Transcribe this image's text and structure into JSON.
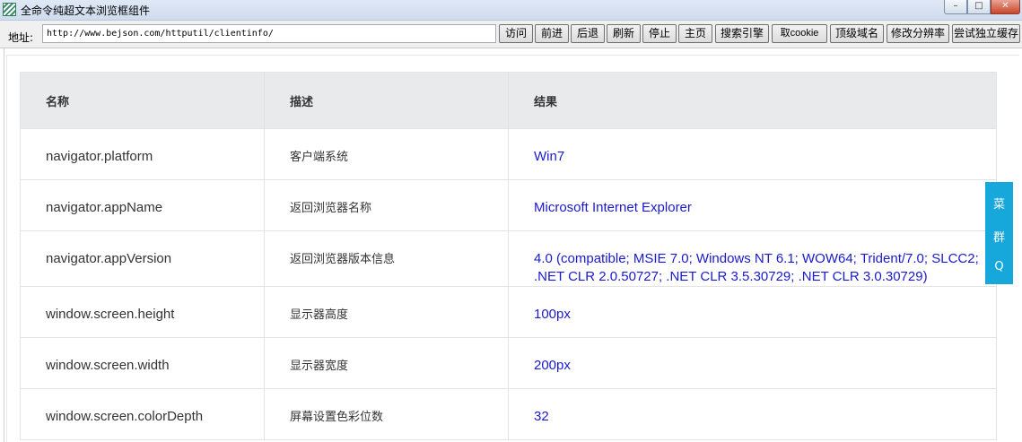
{
  "window": {
    "title": "全命令纯超文本浏览框组件",
    "controls": {
      "minimize": "–",
      "maximize": "□",
      "close": "✕"
    }
  },
  "toolbar": {
    "address_label": "地址:",
    "address_value": "http://www.bejson.com/httputil/clientinfo/",
    "buttons": [
      {
        "label": "访问"
      },
      {
        "label": "前进"
      },
      {
        "label": "后退"
      },
      {
        "label": "刷新"
      },
      {
        "label": "停止"
      },
      {
        "label": "主页"
      },
      {
        "label": "搜索引擎"
      },
      {
        "label": "取cookie"
      },
      {
        "label": "顶级域名"
      },
      {
        "label": "修改分辨率"
      },
      {
        "label": "尝试独立缓存"
      }
    ]
  },
  "table": {
    "headers": [
      "名称",
      "描述",
      "结果"
    ],
    "rows": [
      {
        "name": "navigator.platform",
        "desc": "客户端系统",
        "result": "Win7"
      },
      {
        "name": "navigator.appName",
        "desc": "返回浏览器名称",
        "result": "Microsoft Internet Explorer"
      },
      {
        "name": "navigator.appVersion",
        "desc": "返回浏览器版本信息",
        "result": "4.0 (compatible; MSIE 7.0; Windows NT 6.1; WOW64; Trident/7.0; SLCC2; .NET CLR 2.0.50727; .NET CLR 3.5.30729; .NET CLR 3.0.30729)"
      },
      {
        "name": "window.screen.height",
        "desc": "显示器高度",
        "result": "100px"
      },
      {
        "name": "window.screen.width",
        "desc": "显示器宽度",
        "result": "200px"
      },
      {
        "name": "window.screen.colorDepth",
        "desc": "屏幕设置色彩位数",
        "result": "32"
      }
    ]
  },
  "side_tab": {
    "chars": [
      "菜",
      "群",
      "Q"
    ]
  },
  "colors": {
    "result_text": "#1a1acd",
    "side_tab_bg": "#16a7db",
    "header_bg": "#e9eaeb"
  }
}
